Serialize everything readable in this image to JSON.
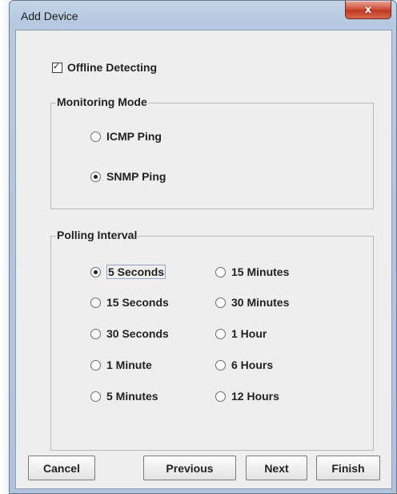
{
  "window": {
    "title": "Add Device",
    "close_glyph": "x"
  },
  "offline_detecting": {
    "label": "Offline Detecting",
    "checked": true
  },
  "monitoring_mode": {
    "title": "Monitoring Mode",
    "options": [
      {
        "label": "ICMP Ping",
        "selected": false
      },
      {
        "label": "SNMP Ping",
        "selected": true
      }
    ]
  },
  "polling_interval": {
    "title": "Polling Interval",
    "options": [
      {
        "label": "5 Seconds",
        "selected": true
      },
      {
        "label": "15 Minutes",
        "selected": false
      },
      {
        "label": "15 Seconds",
        "selected": false
      },
      {
        "label": "30 Minutes",
        "selected": false
      },
      {
        "label": "30 Seconds",
        "selected": false
      },
      {
        "label": "1 Hour",
        "selected": false
      },
      {
        "label": "1 Minute",
        "selected": false
      },
      {
        "label": "6 Hours",
        "selected": false
      },
      {
        "label": "5 Minutes",
        "selected": false
      },
      {
        "label": "12 Hours",
        "selected": false
      }
    ]
  },
  "buttons": {
    "cancel": "Cancel",
    "previous": "Previous",
    "next": "Next",
    "finish": "Finish"
  }
}
